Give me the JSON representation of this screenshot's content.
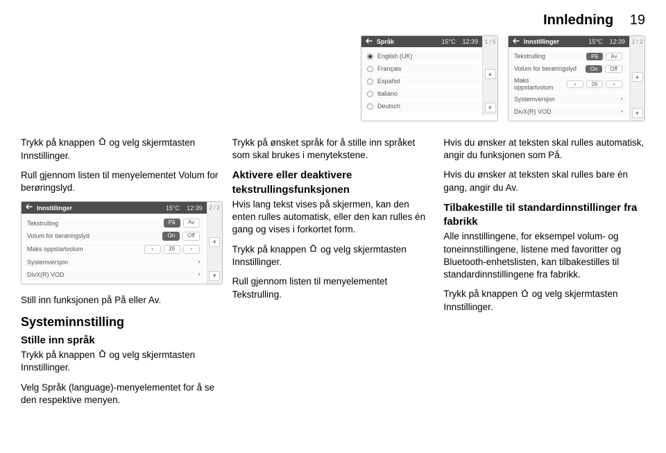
{
  "header": {
    "title": "Innledning",
    "page": "19"
  },
  "icons": {
    "home": "home-icon",
    "back": "back-arrow-icon",
    "up": "▲",
    "down": "▼",
    "left": "‹",
    "right": "›"
  },
  "col1": {
    "p1a": "Trykk på knappen ",
    "p1b": " og velg skjermtasten Innstillinger.",
    "p2": "Rull gjennom listen til menyelementet Volum for berøringslyd.",
    "p3": "Still inn funksjonen på På eller Av.",
    "h2": "Systeminnstilling",
    "h3": "Stille inn språk",
    "p4a": "Trykk på knappen ",
    "p4b": " og velg skjermtasten Innstillinger.",
    "p5": "Velg Språk (language)-menyelementet for å se den respektive menyen."
  },
  "col2": {
    "p1": "Trykk på ønsket språk for å stille inn språket som skal brukes i menytekstene.",
    "h3": "Aktivere eller deaktivere tekstrullingsfunksjonen",
    "p2": "Hvis lang tekst vises på skjermen, kan den enten rulles automatisk, eller den kan rulles én gang og vises i forkortet form.",
    "p3a": "Trykk på knappen ",
    "p3b": " og velg skjermtasten Innstillinger.",
    "p4": "Rull gjennom listen til menyelementet Tekstrulling."
  },
  "col3": {
    "p1": "Hvis du ønsker at teksten skal rulles automatisk, angir du funksjonen som På.",
    "p2": "Hvis du ønsker at teksten skal rulles bare én gang, angir du Av.",
    "h3": "Tilbakestille til standardinnstillinger fra fabrikk",
    "p3": "Alle innstillingene, for eksempel volum- og toneinnstillingene, listene med favoritter og Bluetooth-enhetslisten, kan tilbakestilles til standardinnstillingene fra fabrikk.",
    "p4a": "Trykk på knappen ",
    "p4b": " og velg skjermtasten Innstillinger."
  },
  "screens": {
    "settings": {
      "title": "Innstillinger",
      "temp": "15°C",
      "clock": "12:39",
      "page": "2 / 2",
      "rows": [
        {
          "lbl": "Tekstrulling",
          "a": "På",
          "b": "Av",
          "sel": "a"
        },
        {
          "lbl": "Volum for berøringslyd",
          "a": "On",
          "b": "Off",
          "sel": "a"
        },
        {
          "lbl": "Maks oppstartvolum",
          "a": "‹",
          "b": "26",
          "c": "›"
        },
        {
          "lbl": "Systemversjon",
          "c": "›"
        },
        {
          "lbl": "DivX(R) VOD",
          "c": "›"
        }
      ]
    },
    "lang": {
      "title": "Språk",
      "temp": "15°C",
      "clock": "12:39",
      "page": "1 / 5",
      "rows": [
        {
          "lbl": "English (UK)",
          "sel": true
        },
        {
          "lbl": "Français"
        },
        {
          "lbl": "Español"
        },
        {
          "lbl": "Italiano"
        },
        {
          "lbl": "Deutsch"
        }
      ]
    }
  }
}
